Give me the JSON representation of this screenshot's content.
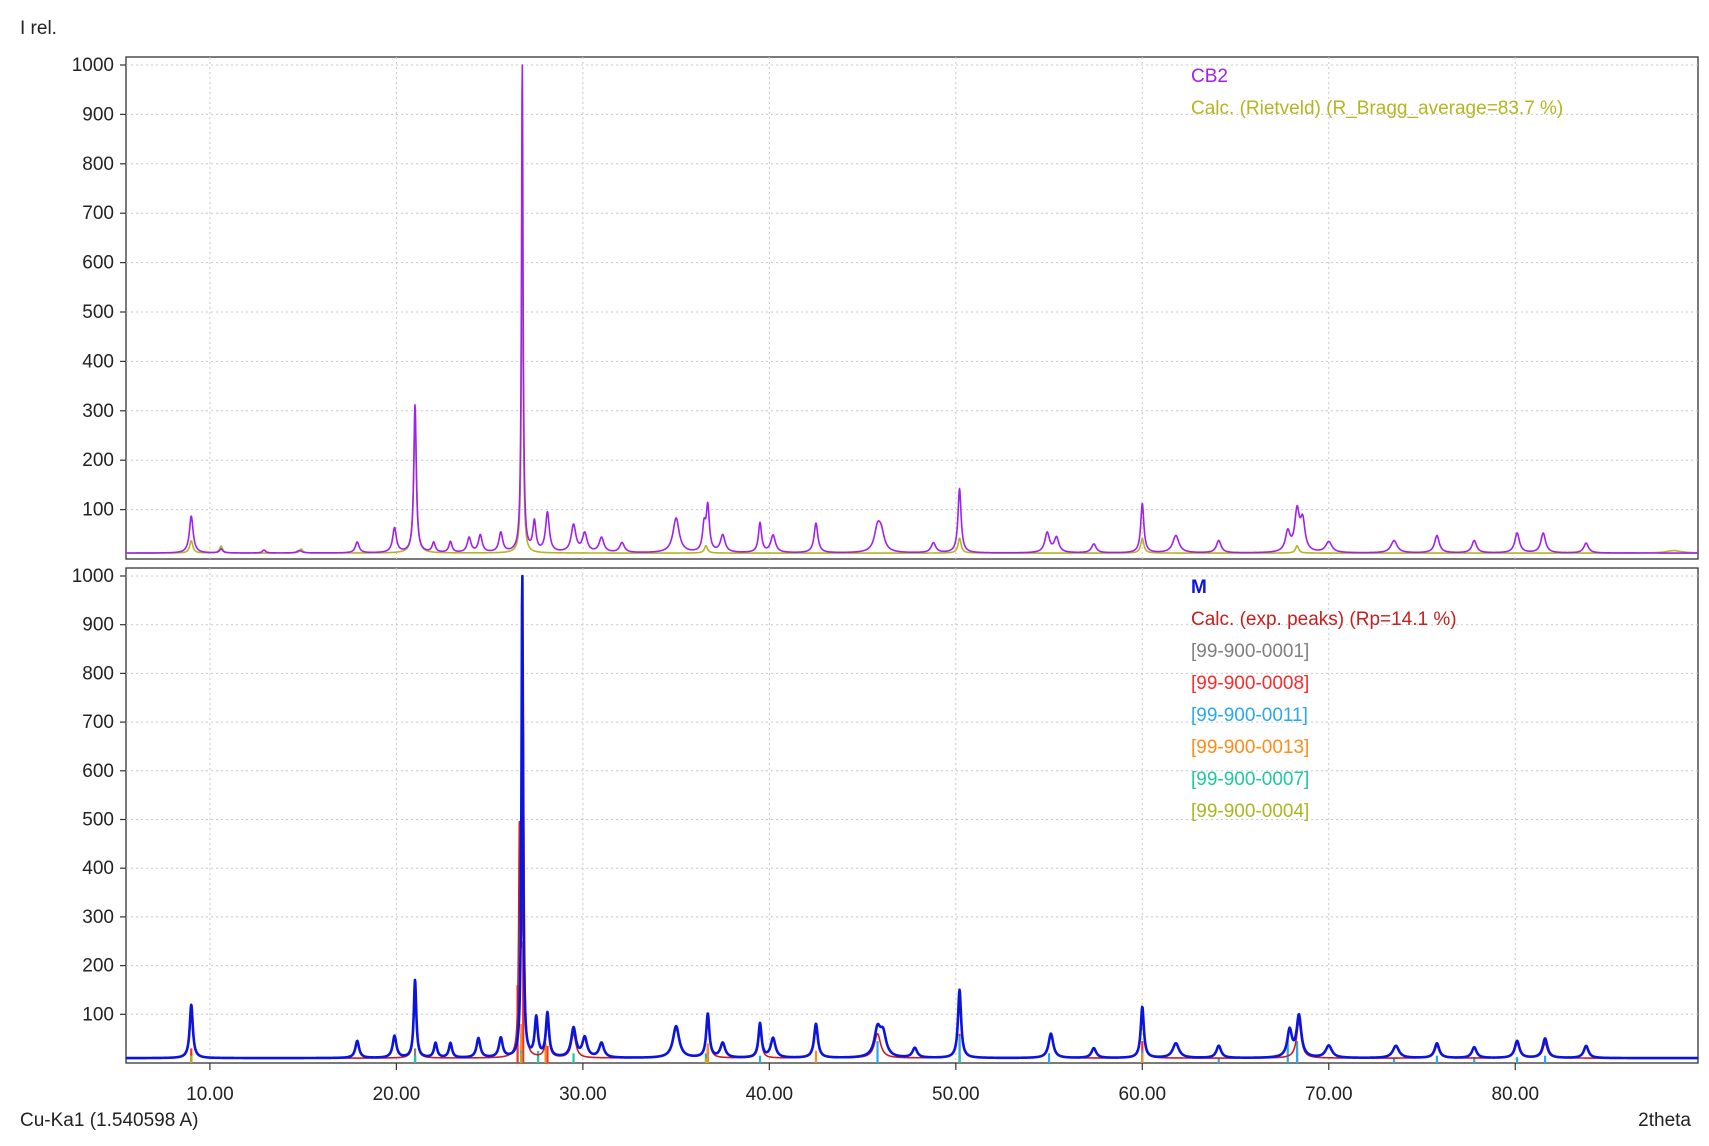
{
  "chart_data": [
    {
      "type": "line",
      "y_axis_title": "I rel.",
      "xlim": [
        5.5,
        89.8
      ],
      "ylim": [
        0,
        1000
      ],
      "yticks": [
        100,
        200,
        300,
        400,
        500,
        600,
        700,
        800,
        900,
        1000
      ],
      "grid": true,
      "legend_position": "top-right",
      "series": [
        {
          "name": "CB2",
          "color": "#a020f0",
          "baseline": 12,
          "peaks": [
            [
              9.0,
              75,
              0.12
            ],
            [
              10.6,
              8,
              0.1
            ],
            [
              12.9,
              6,
              0.1
            ],
            [
              14.8,
              5,
              0.15
            ],
            [
              17.9,
              22,
              0.12
            ],
            [
              19.9,
              50,
              0.12
            ],
            [
              21.0,
              300,
              0.08
            ],
            [
              22.0,
              20,
              0.1
            ],
            [
              22.9,
              22,
              0.1
            ],
            [
              23.9,
              30,
              0.12
            ],
            [
              24.5,
              35,
              0.12
            ],
            [
              25.6,
              40,
              0.12
            ],
            [
              26.75,
              1000,
              0.05
            ],
            [
              27.4,
              60,
              0.1
            ],
            [
              28.1,
              80,
              0.12
            ],
            [
              29.5,
              55,
              0.15
            ],
            [
              30.1,
              38,
              0.15
            ],
            [
              31.0,
              30,
              0.15
            ],
            [
              32.1,
              20,
              0.15
            ],
            [
              35.0,
              70,
              0.2
            ],
            [
              36.5,
              50,
              0.1
            ],
            [
              36.7,
              90,
              0.1
            ],
            [
              37.5,
              35,
              0.15
            ],
            [
              39.5,
              60,
              0.1
            ],
            [
              40.2,
              35,
              0.15
            ],
            [
              42.5,
              60,
              0.12
            ],
            [
              45.8,
              45,
              0.2
            ],
            [
              46.0,
              35,
              0.2
            ],
            [
              48.8,
              20,
              0.15
            ],
            [
              50.2,
              130,
              0.1
            ],
            [
              54.9,
              40,
              0.15
            ],
            [
              55.4,
              30,
              0.15
            ],
            [
              57.4,
              18,
              0.15
            ],
            [
              60.0,
              100,
              0.1
            ],
            [
              61.8,
              35,
              0.2
            ],
            [
              64.1,
              25,
              0.15
            ],
            [
              67.8,
              40,
              0.15
            ],
            [
              68.3,
              80,
              0.15
            ],
            [
              68.6,
              60,
              0.15
            ],
            [
              70.0,
              22,
              0.2
            ],
            [
              73.5,
              25,
              0.2
            ],
            [
              75.8,
              35,
              0.15
            ],
            [
              77.8,
              25,
              0.15
            ],
            [
              80.1,
              40,
              0.15
            ],
            [
              81.5,
              40,
              0.15
            ],
            [
              83.8,
              20,
              0.15
            ]
          ]
        },
        {
          "name": "Calc. (Rietveld) (R_Bragg_average=83.7 %)",
          "color": "#b5b521",
          "baseline": 12,
          "peaks": [
            [
              9.0,
              25,
              0.1
            ],
            [
              10.6,
              14,
              0.1
            ],
            [
              14.9,
              8,
              0.1
            ],
            [
              21.0,
              295,
              0.08
            ],
            [
              26.75,
              720,
              0.05
            ],
            [
              36.6,
              15,
              0.1
            ],
            [
              50.2,
              30,
              0.1
            ],
            [
              60.0,
              30,
              0.1
            ],
            [
              68.3,
              15,
              0.1
            ],
            [
              88.5,
              5,
              0.5
            ]
          ]
        }
      ]
    },
    {
      "type": "line",
      "x_axis_title": "2theta",
      "y_axis_title": "",
      "wavelength_label": "Cu-Ka1 (1.540598 A)",
      "xlim": [
        5.5,
        89.8
      ],
      "ylim": [
        0,
        1000
      ],
      "xticks": [
        "10.00",
        "20.00",
        "30.00",
        "40.00",
        "50.00",
        "60.00",
        "70.00",
        "80.00"
      ],
      "xtick_values": [
        10,
        20,
        30,
        40,
        50,
        60,
        70,
        80
      ],
      "yticks": [
        100,
        200,
        300,
        400,
        500,
        600,
        700,
        800,
        900,
        1000
      ],
      "grid": true,
      "legend_position": "top-right",
      "series": [
        {
          "name": "M",
          "color": "#0a14e0",
          "baseline": 10,
          "peaks": [
            [
              9.0,
              110,
              0.1
            ],
            [
              17.9,
              35,
              0.12
            ],
            [
              19.9,
              45,
              0.12
            ],
            [
              21.0,
              160,
              0.08
            ],
            [
              22.1,
              30,
              0.1
            ],
            [
              22.9,
              30,
              0.1
            ],
            [
              24.4,
              40,
              0.12
            ],
            [
              25.6,
              40,
              0.12
            ],
            [
              26.75,
              1000,
              0.05
            ],
            [
              27.5,
              80,
              0.1
            ],
            [
              28.1,
              90,
              0.1
            ],
            [
              29.5,
              60,
              0.15
            ],
            [
              30.1,
              40,
              0.15
            ],
            [
              31.0,
              30,
              0.15
            ],
            [
              35.0,
              65,
              0.2
            ],
            [
              36.7,
              90,
              0.1
            ],
            [
              37.5,
              30,
              0.15
            ],
            [
              39.5,
              70,
              0.1
            ],
            [
              40.2,
              40,
              0.15
            ],
            [
              42.5,
              70,
              0.12
            ],
            [
              45.8,
              55,
              0.2
            ],
            [
              46.1,
              45,
              0.2
            ],
            [
              47.8,
              20,
              0.15
            ],
            [
              50.2,
              140,
              0.1
            ],
            [
              55.1,
              50,
              0.15
            ],
            [
              57.4,
              20,
              0.15
            ],
            [
              60.0,
              105,
              0.1
            ],
            [
              61.8,
              30,
              0.2
            ],
            [
              64.1,
              25,
              0.15
            ],
            [
              67.9,
              55,
              0.15
            ],
            [
              68.4,
              85,
              0.15
            ],
            [
              70.0,
              25,
              0.2
            ],
            [
              73.6,
              25,
              0.2
            ],
            [
              75.8,
              30,
              0.15
            ],
            [
              77.8,
              22,
              0.15
            ],
            [
              80.1,
              35,
              0.15
            ],
            [
              81.6,
              40,
              0.15
            ],
            [
              83.8,
              25,
              0.15
            ]
          ]
        },
        {
          "name": "Calc. (exp. peaks) (Rp=14.1 %)",
          "color": "#c81e1e",
          "baseline": 10,
          "peaks": [
            [
              9.0,
              95,
              0.1
            ],
            [
              21.0,
              140,
              0.08
            ],
            [
              26.6,
              450,
              0.05
            ],
            [
              26.8,
              700,
              0.05
            ],
            [
              28.1,
              75,
              0.1
            ],
            [
              29.5,
              50,
              0.15
            ],
            [
              35.0,
              60,
              0.2
            ],
            [
              36.7,
              85,
              0.1
            ],
            [
              39.5,
              60,
              0.1
            ],
            [
              42.5,
              60,
              0.12
            ],
            [
              45.8,
              50,
              0.2
            ],
            [
              50.2,
              125,
              0.1
            ],
            [
              55.1,
              45,
              0.15
            ],
            [
              60.0,
              95,
              0.1
            ],
            [
              68.4,
              75,
              0.15
            ],
            [
              75.8,
              25,
              0.15
            ],
            [
              80.1,
              30,
              0.15
            ],
            [
              81.6,
              30,
              0.15
            ]
          ]
        }
      ],
      "reference_patterns": [
        {
          "name": "[99-900-0001]",
          "color": "#808080",
          "sticks": [
            [
              9.0,
              20
            ],
            [
              21.0,
              30
            ],
            [
              26.7,
              60
            ],
            [
              50.2,
              15
            ]
          ]
        },
        {
          "name": "[99-900-0008]",
          "color": "#ff2a2a",
          "sticks": [
            [
              9.0,
              30
            ],
            [
              26.5,
              160
            ],
            [
              26.8,
              250
            ],
            [
              28.1,
              35
            ],
            [
              36.7,
              30
            ],
            [
              50.2,
              60
            ],
            [
              60.0,
              45
            ],
            [
              68.3,
              30
            ]
          ]
        },
        {
          "name": "[99-900-0011]",
          "color": "#29a8f0",
          "sticks": [
            [
              21.0,
              15
            ],
            [
              26.7,
              30
            ],
            [
              36.6,
              20
            ],
            [
              39.5,
              15
            ],
            [
              45.8,
              45
            ],
            [
              50.2,
              55
            ],
            [
              55.0,
              20
            ],
            [
              60.0,
              25
            ],
            [
              64.1,
              10
            ],
            [
              67.8,
              55
            ],
            [
              68.3,
              45
            ],
            [
              73.5,
              10
            ],
            [
              75.8,
              15
            ],
            [
              77.8,
              10
            ],
            [
              80.1,
              12
            ],
            [
              81.6,
              15
            ]
          ]
        },
        {
          "name": "[99-900-0013]",
          "color": "#ff8c1a",
          "sticks": [
            [
              26.7,
              80
            ],
            [
              28.0,
              40
            ],
            [
              36.7,
              40
            ],
            [
              42.5,
              25
            ],
            [
              60.0,
              20
            ]
          ]
        },
        {
          "name": "[99-900-0007]",
          "color": "#1ec8a0",
          "sticks": [
            [
              21.0,
              15
            ],
            [
              26.7,
              25
            ],
            [
              27.6,
              25
            ],
            [
              29.5,
              20
            ],
            [
              50.2,
              15
            ]
          ]
        },
        {
          "name": "[99-900-0004]",
          "color": "#a8b820",
          "sticks": [
            [
              9.0,
              15
            ],
            [
              26.7,
              20
            ],
            [
              36.6,
              10
            ]
          ]
        }
      ]
    }
  ]
}
